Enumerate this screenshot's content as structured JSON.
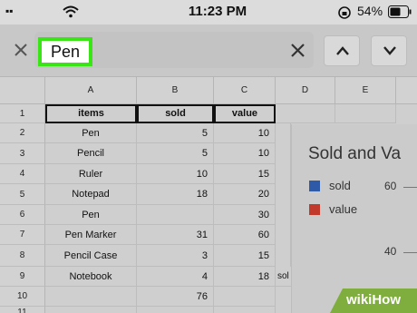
{
  "status_bar": {
    "carrier": "▪▪",
    "time": "11:23 PM",
    "battery": "54%"
  },
  "find_bar": {
    "search_value": "Pen"
  },
  "sheet": {
    "columns": [
      "A",
      "B",
      "C",
      "D",
      "E"
    ],
    "rows": [
      "1",
      "2",
      "3",
      "4",
      "5",
      "6",
      "7",
      "8",
      "9",
      "10",
      "11"
    ],
    "headers": [
      "items",
      "sold",
      "value"
    ],
    "data": [
      [
        "Pen",
        "5",
        "10"
      ],
      [
        "Pencil",
        "5",
        "10"
      ],
      [
        "Ruler",
        "10",
        "15"
      ],
      [
        "Notepad",
        "18",
        "20"
      ],
      [
        "Pen",
        "",
        "30"
      ],
      [
        "Pen Marker",
        "31",
        "60"
      ],
      [
        "Pencil Case",
        "3",
        "15"
      ],
      [
        "Notebook",
        "4",
        "18"
      ],
      [
        "",
        "76",
        ""
      ]
    ],
    "overflow_text": "sol"
  },
  "chart": {
    "title_fragment": "Sold and Va",
    "legend": [
      {
        "label": "sold",
        "color": "#2f5aa8"
      },
      {
        "label": "value",
        "color": "#c0392b"
      }
    ],
    "ticks": [
      "60",
      "40"
    ]
  },
  "watermark": {
    "text": "wikiHow"
  },
  "colors": {
    "highlight": "#39e515",
    "watermark": "#7fae3e"
  }
}
